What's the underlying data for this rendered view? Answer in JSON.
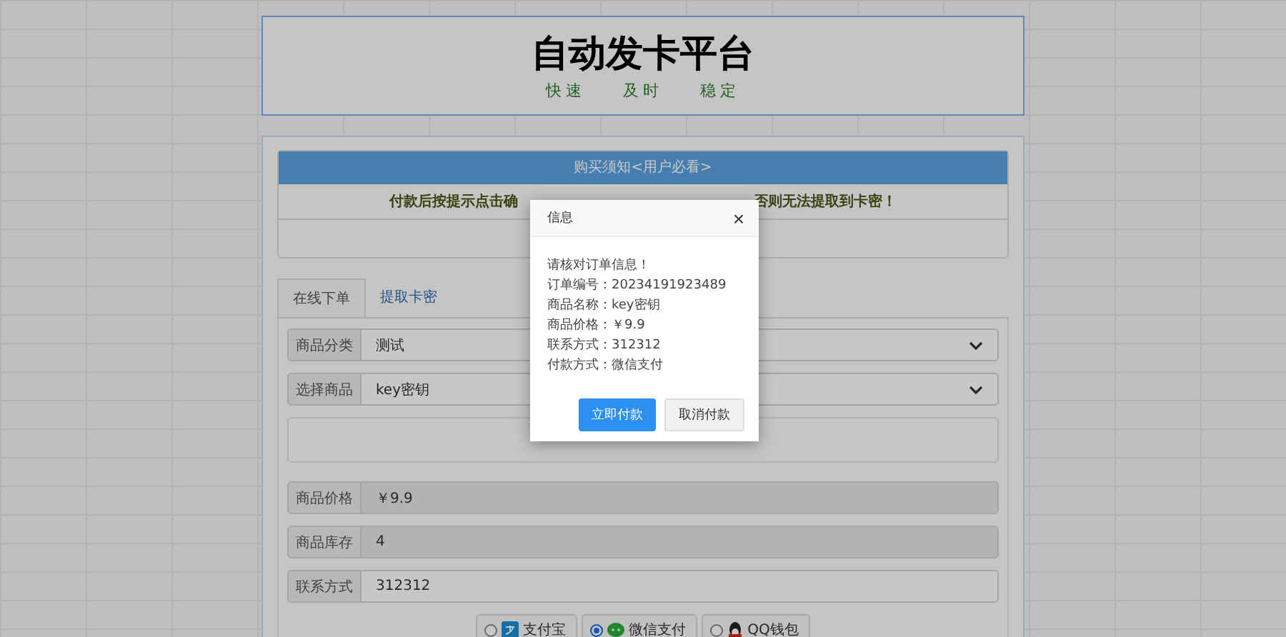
{
  "header": {
    "title": "自动发卡平台",
    "slogans": [
      "快速",
      "及时",
      "稳定"
    ]
  },
  "notice": {
    "title": "购买须知<用户必看>",
    "text_left": "付款后按提示点击确",
    "text_right": "否则无法提取到卡密！"
  },
  "tabs": [
    {
      "label": "在线下单",
      "selected": true
    },
    {
      "label": "提取卡密",
      "selected": false
    }
  ],
  "form": [
    {
      "kind": "select",
      "label": "商品分类",
      "value": "测试"
    },
    {
      "kind": "select",
      "label": "选择商品",
      "value": "key密钥"
    },
    {
      "kind": "blank"
    },
    {
      "kind": "readonly",
      "label": "商品价格",
      "value": "￥9.9"
    },
    {
      "kind": "readonly",
      "label": "商品库存",
      "value": "4"
    },
    {
      "kind": "input",
      "label": "联系方式",
      "value": "312312"
    }
  ],
  "payments": [
    {
      "kind": "alipay",
      "label": "支付宝",
      "selected": false
    },
    {
      "kind": "wechat",
      "label": "微信支付",
      "selected": true
    },
    {
      "kind": "qq",
      "label": "QQ钱包",
      "selected": false
    }
  ],
  "dialog": {
    "title": "信息",
    "close": "×",
    "lines": [
      "请核对订单信息！",
      "订单编号：20234191923489",
      "商品名称：key密钥",
      "商品价格：￥9.9",
      "联系方式：312312",
      "付款方式：微信支付"
    ],
    "buttons": [
      {
        "kind": "primary",
        "label": "立即付款"
      },
      {
        "kind": "secondary",
        "label": "取消付款"
      }
    ]
  }
}
